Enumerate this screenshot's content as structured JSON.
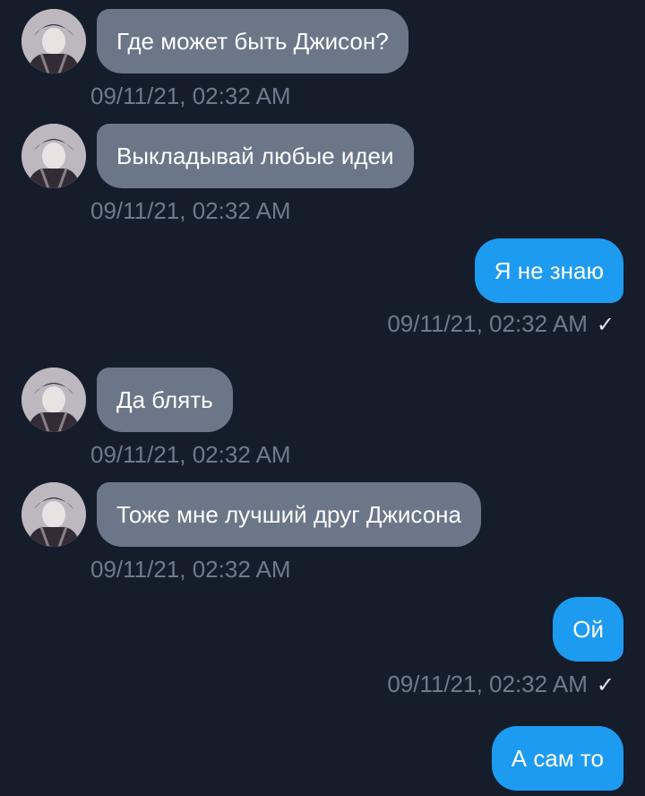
{
  "messages": [
    {
      "side": "in",
      "text": "Где может быть Джисон?",
      "time": "09/11/21, 02:32 AM"
    },
    {
      "side": "in",
      "text": "Выкладывай любые идеи",
      "time": "09/11/21, 02:32 AM"
    },
    {
      "side": "out",
      "text": "Я не знаю",
      "time": "09/11/21, 02:32 AM",
      "status_icon": "check-icon"
    },
    {
      "side": "in",
      "text": "Да блять",
      "time": "09/11/21, 02:32 AM"
    },
    {
      "side": "in",
      "text": "Тоже мне лучший друг Джисона",
      "time": "09/11/21, 02:32 AM"
    },
    {
      "side": "out",
      "text": "Ой",
      "time": "09/11/21, 02:32 AM",
      "status_icon": "check-icon"
    },
    {
      "side": "out",
      "text": "А сам то"
    }
  ],
  "colors": {
    "background": "#151d2b",
    "incoming_bubble": "#6b7689",
    "outgoing_bubble": "#1d9bf0",
    "timestamp": "#6f7a8c"
  },
  "check_glyph": "✓"
}
